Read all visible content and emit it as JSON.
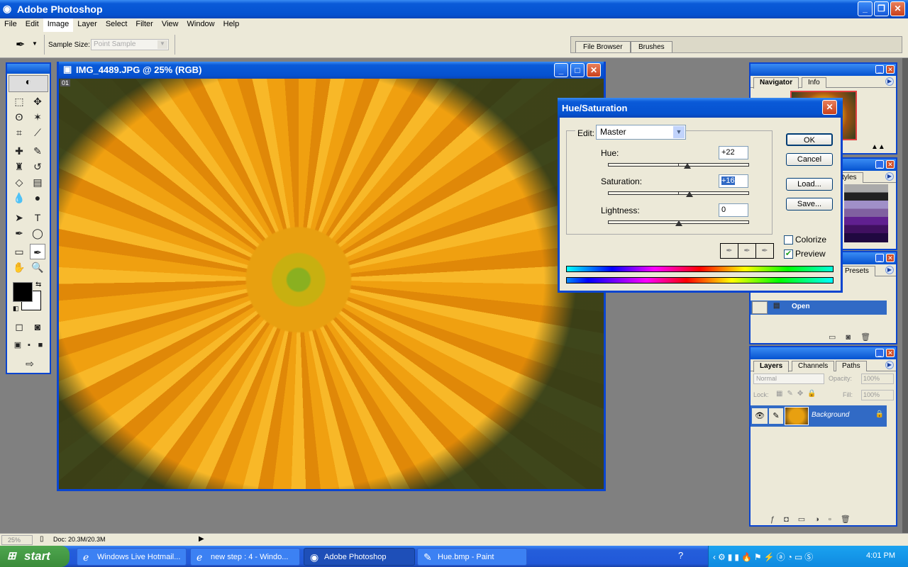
{
  "app": {
    "title": "Adobe Photoshop"
  },
  "menu": [
    "File",
    "Edit",
    "Image",
    "Layer",
    "Select",
    "Filter",
    "View",
    "Window",
    "Help"
  ],
  "options": {
    "sample_size_label": "Sample Size:",
    "sample_size_value": "Point Sample"
  },
  "palette_well": {
    "tabs": [
      "File Browser",
      "Brushes"
    ]
  },
  "document": {
    "title": "IMG_4489.JPG @ 25% (RGB)",
    "channel_label": "01"
  },
  "dialog": {
    "title": "Hue/Saturation",
    "edit_label": "Edit:",
    "edit_value": "Master",
    "hue_label": "Hue:",
    "hue_value": "+22",
    "hue": 22,
    "saturation_label": "Saturation:",
    "saturation_value": "+16",
    "saturation": 16,
    "lightness_label": "Lightness:",
    "lightness_value": "0",
    "lightness": 0,
    "buttons": {
      "ok": "OK",
      "cancel": "Cancel",
      "load": "Load...",
      "save": "Save..."
    },
    "colorize_label": "Colorize",
    "colorize_checked": false,
    "preview_label": "Preview",
    "preview_checked": true
  },
  "panels": {
    "navigator": {
      "tabs": [
        "Navigator",
        "Info"
      ]
    },
    "swatches": {
      "tabs": [
        "tyles"
      ]
    },
    "history": {
      "tabs": [
        "Presets"
      ],
      "item": "Open"
    },
    "layers": {
      "tabs": [
        "Layers",
        "Channels",
        "Paths"
      ],
      "blend_mode": "Normal",
      "opacity_label": "Opacity:",
      "opacity": "100%",
      "lock_label": "Lock:",
      "fill_label": "Fill:",
      "fill": "100%",
      "layer_name": "Background"
    }
  },
  "status": {
    "zoom": "25%",
    "doc": "Doc: 20.3M/20.3M"
  },
  "taskbar": {
    "start": "start",
    "tasks": [
      "Windows Live Hotmail...",
      "new step : 4 - Windo...",
      "Adobe Photoshop",
      "Hue.bmp - Paint"
    ],
    "clock": "4:01 PM"
  },
  "colors": {
    "xp_blue": "#0a5ad8",
    "face": "#ece9d8",
    "selection": "#316ac5",
    "workspace": "#808080"
  }
}
